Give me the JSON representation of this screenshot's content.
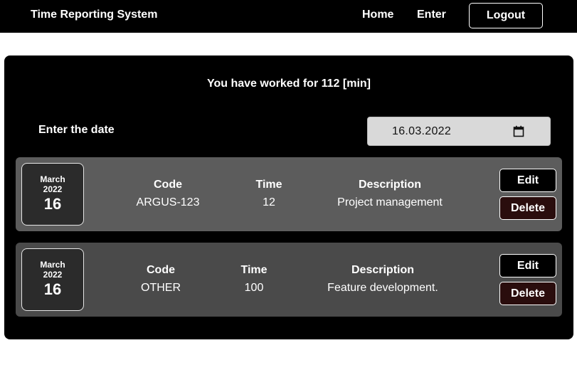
{
  "nav": {
    "brand": "Time Reporting System",
    "home": "Home",
    "enter": "Enter",
    "logout": "Logout"
  },
  "summary": {
    "worked_text": "You have worked for 112 [min]"
  },
  "date_picker": {
    "label": "Enter the date",
    "value": "16.03.2022",
    "icon": "calendar-icon"
  },
  "columns": {
    "code": "Code",
    "time": "Time",
    "description": "Description"
  },
  "entries": [
    {
      "month": "March",
      "year": "2022",
      "day": "16",
      "code": "ARGUS-123",
      "time": "12",
      "description": "Project management",
      "edit_label": "Edit",
      "delete_label": "Delete"
    },
    {
      "month": "March",
      "year": "2022",
      "day": "16",
      "code": "OTHER",
      "time": "100",
      "description": "Feature development.",
      "edit_label": "Edit",
      "delete_label": "Delete"
    }
  ],
  "colors": {
    "navbar": "#000000",
    "panel": "#000000",
    "entry_1_bg": "#5c5c5c",
    "entry_2_bg": "#4a4a4a",
    "delete_bg": "#2a0d0d",
    "date_input_bg": "#d9d9d9"
  }
}
